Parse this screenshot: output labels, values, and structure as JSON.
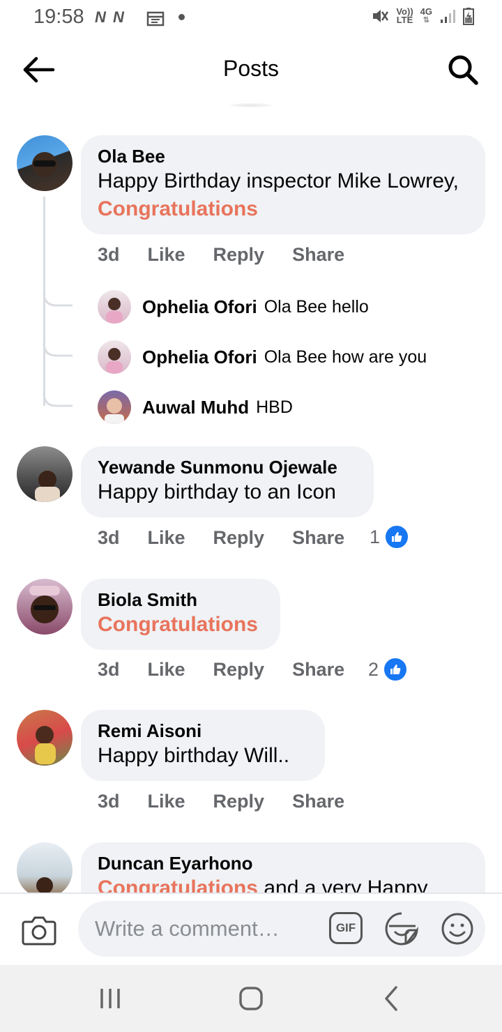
{
  "status_bar": {
    "time": "19:58",
    "network_marks": "N N",
    "volte_label": "Vo))\nLTE",
    "network_type": "4G"
  },
  "header": {
    "title": "Posts",
    "back_icon": "arrow-left-icon",
    "search_icon": "search-icon"
  },
  "comments": [
    {
      "author": "Ola Bee",
      "text_before": "Happy Birthday inspector Mike Lowrey,",
      "highlight": "Congratulations",
      "time": "3d",
      "like_label": "Like",
      "reply_label": "Reply",
      "share_label": "Share",
      "replies": [
        {
          "author": "Ophelia Ofori",
          "text": "Ola Bee hello"
        },
        {
          "author": "Ophelia Ofori",
          "text": "Ola Bee how are you"
        },
        {
          "author": "Auwal Muhd",
          "text": "HBD"
        }
      ]
    },
    {
      "author": "Yewande Sunmonu Ojewale",
      "text": "Happy birthday to an Icon",
      "time": "3d",
      "like_label": "Like",
      "reply_label": "Reply",
      "share_label": "Share",
      "reaction_count": "1"
    },
    {
      "author": "Biola Smith",
      "highlight": "Congratulations",
      "time": "3d",
      "like_label": "Like",
      "reply_label": "Reply",
      "share_label": "Share",
      "reaction_count": "2"
    },
    {
      "author": "Remi Aisoni",
      "text": "Happy birthday Will..",
      "time": "3d",
      "like_label": "Like",
      "reply_label": "Reply",
      "share_label": "Share"
    },
    {
      "author": "Duncan Eyarhono",
      "highlight": "Congratulations",
      "text_after": " and a very Happy"
    }
  ],
  "composer": {
    "placeholder": "Write a comment…",
    "camera_icon": "camera-icon",
    "gif_label": "GIF",
    "sticker_icon": "sticker-icon",
    "emoji_icon": "emoji-icon"
  },
  "nav_bar": {
    "recents_icon": "recents-icon",
    "home_icon": "home-icon",
    "back_icon": "nav-back-icon"
  },
  "colors": {
    "mention": "#e8745c",
    "bubble": "#f0f2f5",
    "like_blue": "#1877f2",
    "meta_gray": "#65676b"
  }
}
